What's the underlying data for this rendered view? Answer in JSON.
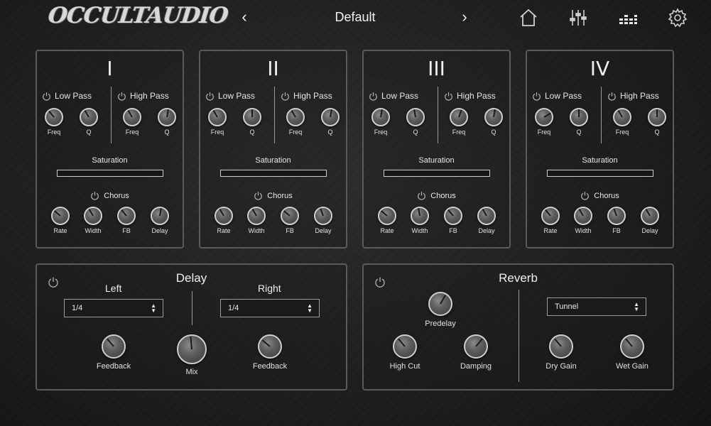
{
  "header": {
    "logo_text": "OCCULTAUDIO",
    "preset_name": "Default",
    "prev_icon": "chevron-left-icon",
    "next_icon": "chevron-right-icon",
    "icons": [
      "home-icon",
      "sliders-icon",
      "meter-bars-icon",
      "gear-icon"
    ]
  },
  "bands": [
    {
      "numeral": "I",
      "low_pass": {
        "label": "Low Pass",
        "freq_label": "Freq",
        "q_label": "Q"
      },
      "high_pass": {
        "label": "High Pass",
        "freq_label": "Freq",
        "q_label": "Q"
      },
      "saturation_label": "Saturation",
      "chorus": {
        "label": "Chorus",
        "rate_label": "Rate",
        "width_label": "Width",
        "fb_label": "FB",
        "delay_label": "Delay"
      }
    },
    {
      "numeral": "II",
      "low_pass": {
        "label": "Low Pass",
        "freq_label": "Freq",
        "q_label": "Q"
      },
      "high_pass": {
        "label": "High Pass",
        "freq_label": "Freq",
        "q_label": "Q"
      },
      "saturation_label": "Saturation",
      "chorus": {
        "label": "Chorus",
        "rate_label": "Rate",
        "width_label": "Width",
        "fb_label": "FB",
        "delay_label": "Delay"
      }
    },
    {
      "numeral": "III",
      "low_pass": {
        "label": "Low Pass",
        "freq_label": "Freq",
        "q_label": "Q"
      },
      "high_pass": {
        "label": "High Pass",
        "freq_label": "Freq",
        "q_label": "Q"
      },
      "saturation_label": "Saturation",
      "chorus": {
        "label": "Chorus",
        "rate_label": "Rate",
        "width_label": "Width",
        "fb_label": "FB",
        "delay_label": "Delay"
      }
    },
    {
      "numeral": "IV",
      "low_pass": {
        "label": "Low Pass",
        "freq_label": "Freq",
        "q_label": "Q"
      },
      "high_pass": {
        "label": "High Pass",
        "freq_label": "Freq",
        "q_label": "Q"
      },
      "saturation_label": "Saturation",
      "chorus": {
        "label": "Chorus",
        "rate_label": "Rate",
        "width_label": "Width",
        "fb_label": "FB",
        "delay_label": "Delay"
      }
    }
  ],
  "delay": {
    "title": "Delay",
    "left": {
      "label": "Left",
      "value": "1/4",
      "feedback_label": "Feedback"
    },
    "right": {
      "label": "Right",
      "value": "1/4",
      "feedback_label": "Feedback"
    },
    "mix_label": "Mix"
  },
  "reverb": {
    "title": "Reverb",
    "predelay_label": "Predelay",
    "high_cut_label": "High Cut",
    "damping_label": "Damping",
    "type_value": "Tunnel",
    "dry_gain_label": "Dry Gain",
    "wet_gain_label": "Wet Gain"
  },
  "colors": {
    "panel_border": "#5a5a5a",
    "knob_ring": "#cfcfcf",
    "text": "#e8e8e8"
  }
}
